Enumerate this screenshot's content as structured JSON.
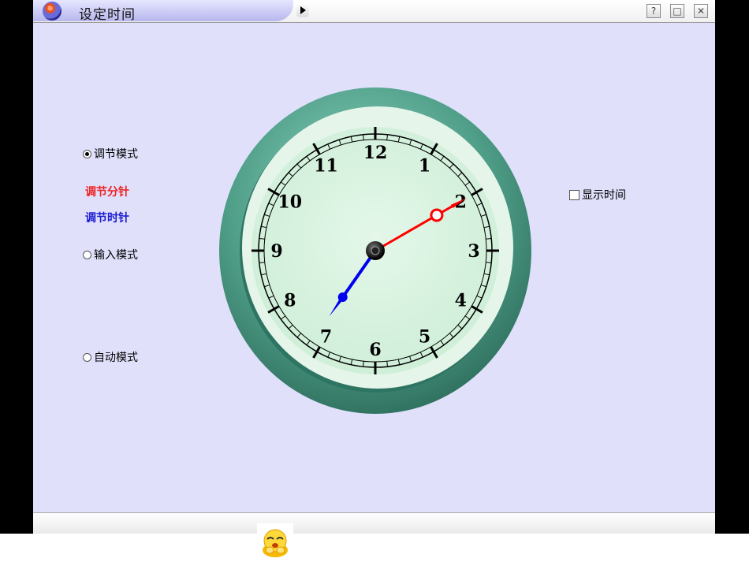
{
  "window": {
    "title": "设定时间",
    "help_label": "?",
    "max_label": "□",
    "close_label": "✕"
  },
  "modes": {
    "adjust_label": "调节模式",
    "adjust_minute_label": "调节分针",
    "adjust_hour_label": "调节时针",
    "input_label": "输入模式",
    "auto_label": "自动模式",
    "selected": "adjust"
  },
  "show_time": {
    "label": "显示时间",
    "checked": false
  },
  "clock": {
    "numbers": [
      "12",
      "1",
      "2",
      "3",
      "4",
      "5",
      "6",
      "7",
      "8",
      "9",
      "10",
      "11"
    ],
    "hour": 7,
    "minute": 10,
    "minute_hand_color": "#ff0000",
    "hour_hand_color": "#0000ee"
  },
  "colors": {
    "minute_label": "#ee2222",
    "hour_label": "#1a1ad0",
    "background": "#e0e0fb"
  }
}
